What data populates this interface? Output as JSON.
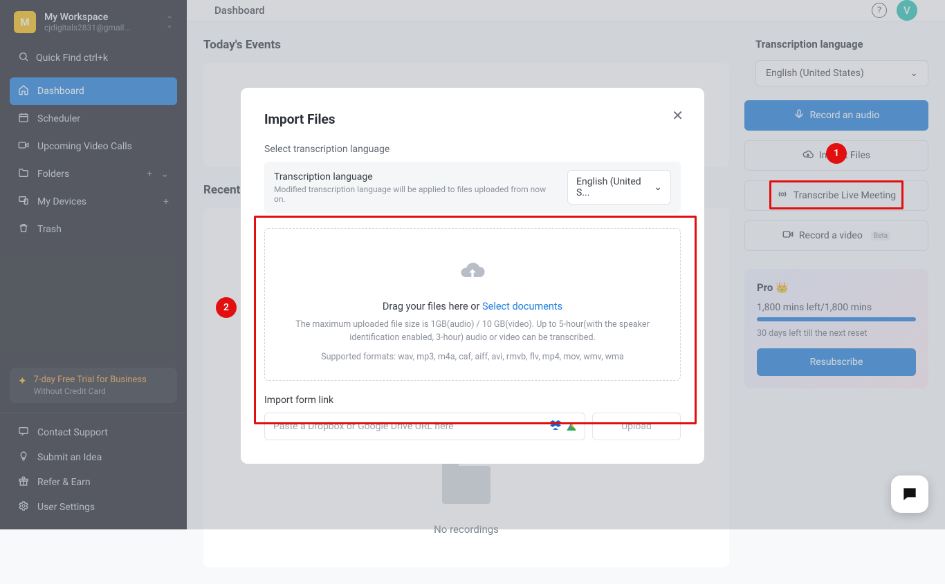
{
  "workspace": {
    "initial": "M",
    "name": "My Workspace",
    "email": "cjdigitals2831@gmail..."
  },
  "quickfind": "Quick Find ctrl+k",
  "nav": {
    "dashboard": "Dashboard",
    "scheduler": "Scheduler",
    "upcoming": "Upcoming Video Calls",
    "folders": "Folders",
    "devices": "My Devices",
    "trash": "Trash"
  },
  "trial": {
    "title": "7-day Free Trial for Business",
    "sub": "Without Credit Card"
  },
  "bottom_nav": {
    "support": "Contact Support",
    "idea": "Submit an Idea",
    "refer": "Refer & Earn",
    "settings": "User Settings"
  },
  "topbar": {
    "title": "Dashboard",
    "avatar": "V"
  },
  "sections": {
    "today": "Today's Events",
    "recent": "Recent",
    "no_recordings": "No recordings"
  },
  "right": {
    "lang_label": "Transcription language",
    "lang_value": "English (United States)",
    "record_audio": "Record an audio",
    "import_files": "Import Files",
    "live_meeting": "Transcribe Live Meeting",
    "record_video": "Record a video",
    "beta": "Beta"
  },
  "pro": {
    "title": "Pro",
    "mins": "1,800 mins left/1,800 mins",
    "days": "30 days left till the next reset",
    "btn": "Resubscribe"
  },
  "modal": {
    "title": "Import Files",
    "sub": "Select transcription language",
    "lang_title": "Transcription language",
    "lang_note": "Modified transcription language will be applied to files uploaded from now on.",
    "lang_value": "English (United S...",
    "drag_prefix": "Drag your files here or ",
    "drag_link": "Select documents",
    "note1": "The maximum uploaded file size is 1GB(audio) / 10 GB(video). Up to 5-hour(with the speaker identification enabled, 3-hour) audio or video can be transcribed.",
    "note2": "Supported formats: wav, mp3, m4a, caf, aiff, avi, rmvb, flv, mp4, mov, wmv, wma",
    "link_label": "Import form link",
    "link_placeholder": "Paste a Dropbox or Google Drive URL here",
    "upload": "Upload"
  },
  "annotations": {
    "b1": "1",
    "b2": "2"
  }
}
